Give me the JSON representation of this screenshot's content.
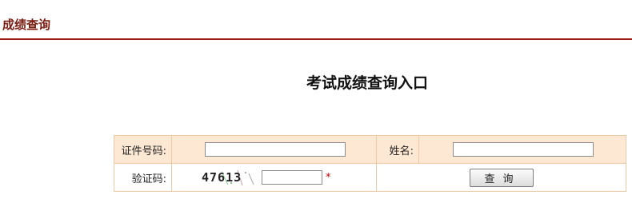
{
  "header": {
    "title": "成绩查询"
  },
  "main": {
    "title": "考试成绩查询入口"
  },
  "form": {
    "id_label": "证件号码:",
    "id_value": "",
    "name_label": "姓名:",
    "name_value": "",
    "captcha_label": "验证码:",
    "captcha_text": "47613",
    "captcha_value": "",
    "required_mark": "*",
    "submit_label": "查询"
  }
}
